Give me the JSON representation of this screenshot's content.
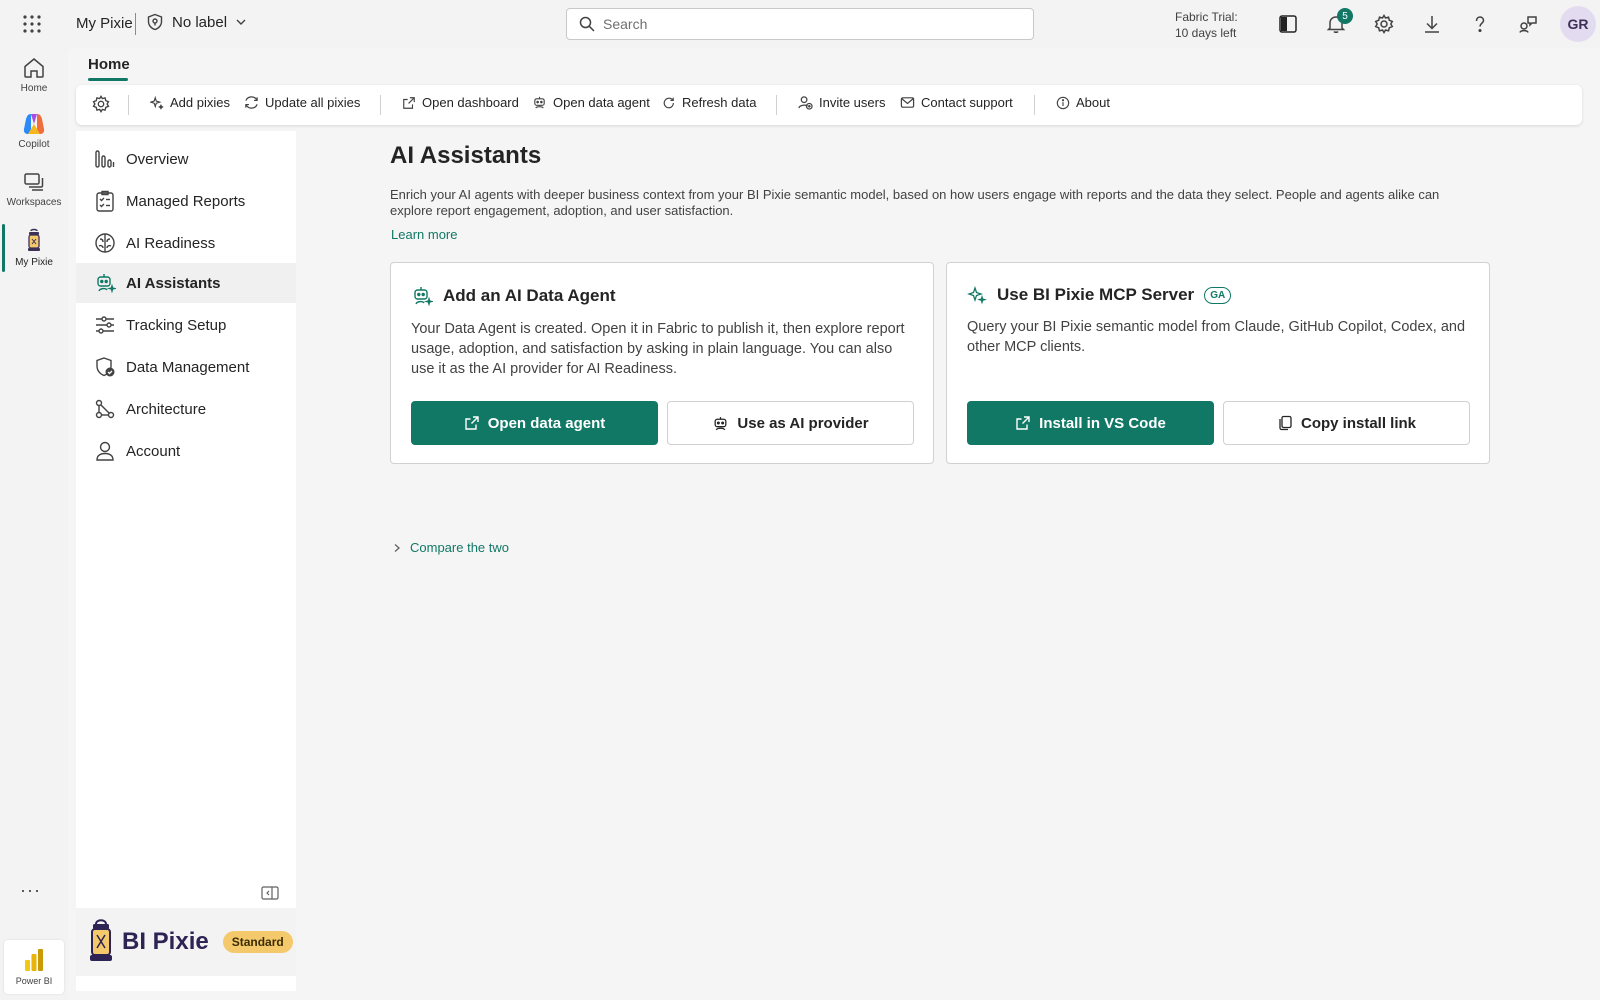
{
  "colors": {
    "accent": "#117865",
    "badge": "#f4c96b",
    "brand_text": "#2e2454"
  },
  "topbar": {
    "workspace": "My Pixie",
    "label": "No label",
    "search_placeholder": "Search",
    "trial_line1": "Fabric Trial:",
    "trial_line2": "10 days left",
    "notification_count": "5",
    "avatar_initials": "GR"
  },
  "rail": {
    "items": [
      {
        "label": "Home",
        "icon": "home-icon"
      },
      {
        "label": "Copilot",
        "icon": "copilot-icon"
      },
      {
        "label": "Workspaces",
        "icon": "workspaces-icon"
      },
      {
        "label": "My Pixie",
        "icon": "lantern-icon"
      }
    ],
    "more": "···",
    "bottom_app": "Power BI"
  },
  "tabs": {
    "home": "Home"
  },
  "ribbon": {
    "add_pixies": "Add pixies",
    "update_all": "Update all pixies",
    "open_dashboard": "Open dashboard",
    "open_data_agent": "Open data agent",
    "refresh_data": "Refresh data",
    "invite_users": "Invite users",
    "contact_support": "Contact support",
    "about": "About"
  },
  "nav": {
    "items": [
      {
        "label": "Overview",
        "icon": "chart-bars-icon"
      },
      {
        "label": "Managed Reports",
        "icon": "checklist-icon"
      },
      {
        "label": "AI Readiness",
        "icon": "brain-icon"
      },
      {
        "label": "AI Assistants",
        "icon": "bot-sparkle-icon",
        "active": true
      },
      {
        "label": "Tracking Setup",
        "icon": "sliders-icon"
      },
      {
        "label": "Data Management",
        "icon": "shield-check-icon"
      },
      {
        "label": "Architecture",
        "icon": "flow-icon"
      },
      {
        "label": "Account",
        "icon": "person-icon"
      }
    ]
  },
  "brand": {
    "name": "BI Pixie",
    "tier": "Standard"
  },
  "page": {
    "title": "AI Assistants",
    "description": "Enrich your AI agents with deeper business context from your BI Pixie semantic model, based on how users engage with reports and the data they select. People and agents alike can explore report engagement, adoption, and user satisfaction.",
    "learn_more": "Learn more",
    "compare": "Compare the two"
  },
  "cards": {
    "agent": {
      "title": "Add an AI Data Agent",
      "body": "Your Data Agent is created. Open it in Fabric to publish it, then explore report usage, adoption, and satisfaction by asking in plain language. You can also use it as the AI provider for AI Readiness.",
      "primary": "Open data agent",
      "secondary": "Use as AI provider"
    },
    "mcp": {
      "title": "Use BI Pixie MCP Server",
      "badge": "GA",
      "body": "Query your BI Pixie semantic model from Claude, GitHub Copilot, Codex, and other MCP clients.",
      "primary": "Install in VS Code",
      "secondary": "Copy install link"
    }
  }
}
